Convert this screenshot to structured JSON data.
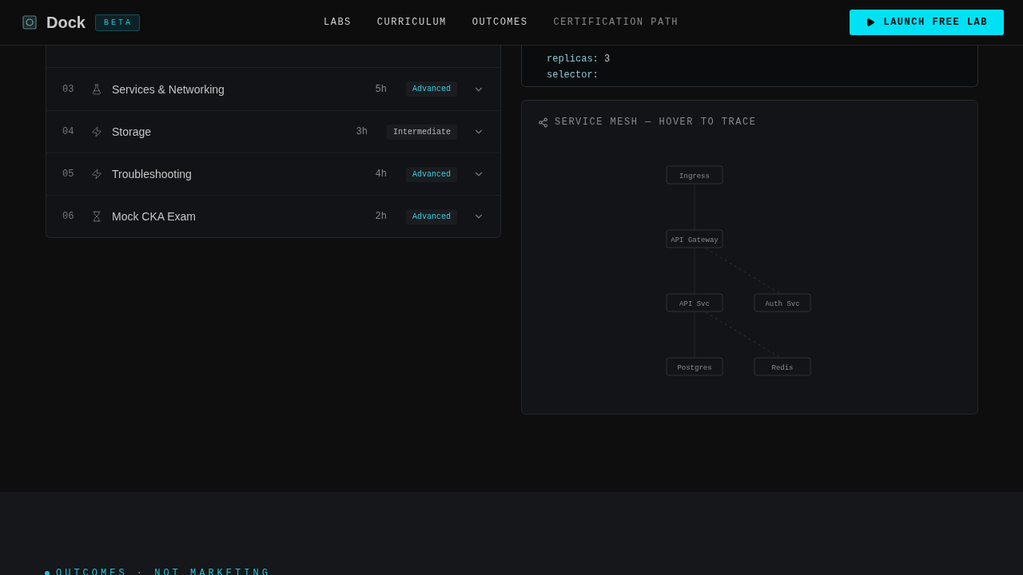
{
  "header": {
    "brand": "Dock",
    "badge": "BETA",
    "nav": [
      {
        "label": "LABS",
        "muted": false
      },
      {
        "label": "CURRICULUM",
        "muted": false
      },
      {
        "label": "OUTCOMES",
        "muted": false
      },
      {
        "label": "CERTIFICATION PATH",
        "muted": true
      }
    ],
    "cta": "LAUNCH FREE LAB"
  },
  "modules": [
    {
      "number": "03",
      "kind": "lab",
      "title": "Services & Networking",
      "duration": "5h",
      "accent": true,
      "difficulty": "Advanced"
    },
    {
      "number": "04",
      "kind": "drill",
      "title": "Storage",
      "duration": "3h",
      "accent": false,
      "difficulty": "Intermediate"
    },
    {
      "number": "05",
      "kind": "drill",
      "title": "Troubleshooting",
      "duration": "4h",
      "accent": true,
      "difficulty": "Advanced"
    },
    {
      "number": "06",
      "kind": "exam",
      "title": "Mock CKA Exam",
      "duration": "2h",
      "accent": true,
      "difficulty": "Advanced"
    }
  ],
  "code": [
    {
      "key": "replicas:",
      "value": "3"
    },
    {
      "key": "selector:"
    }
  ],
  "mesh": {
    "title": "SERVICE MESH — HOVER TO TRACE",
    "nodes": [
      {
        "label": "Ingress"
      },
      {
        "label": "API Gateway"
      },
      {
        "label": "API Svc"
      },
      {
        "label": "Auth Svc"
      },
      {
        "label": "Postgres"
      },
      {
        "label": "Redis"
      }
    ]
  },
  "outcomes": {
    "eyebrow": "OUTCOMES · NOT MARKETING"
  }
}
